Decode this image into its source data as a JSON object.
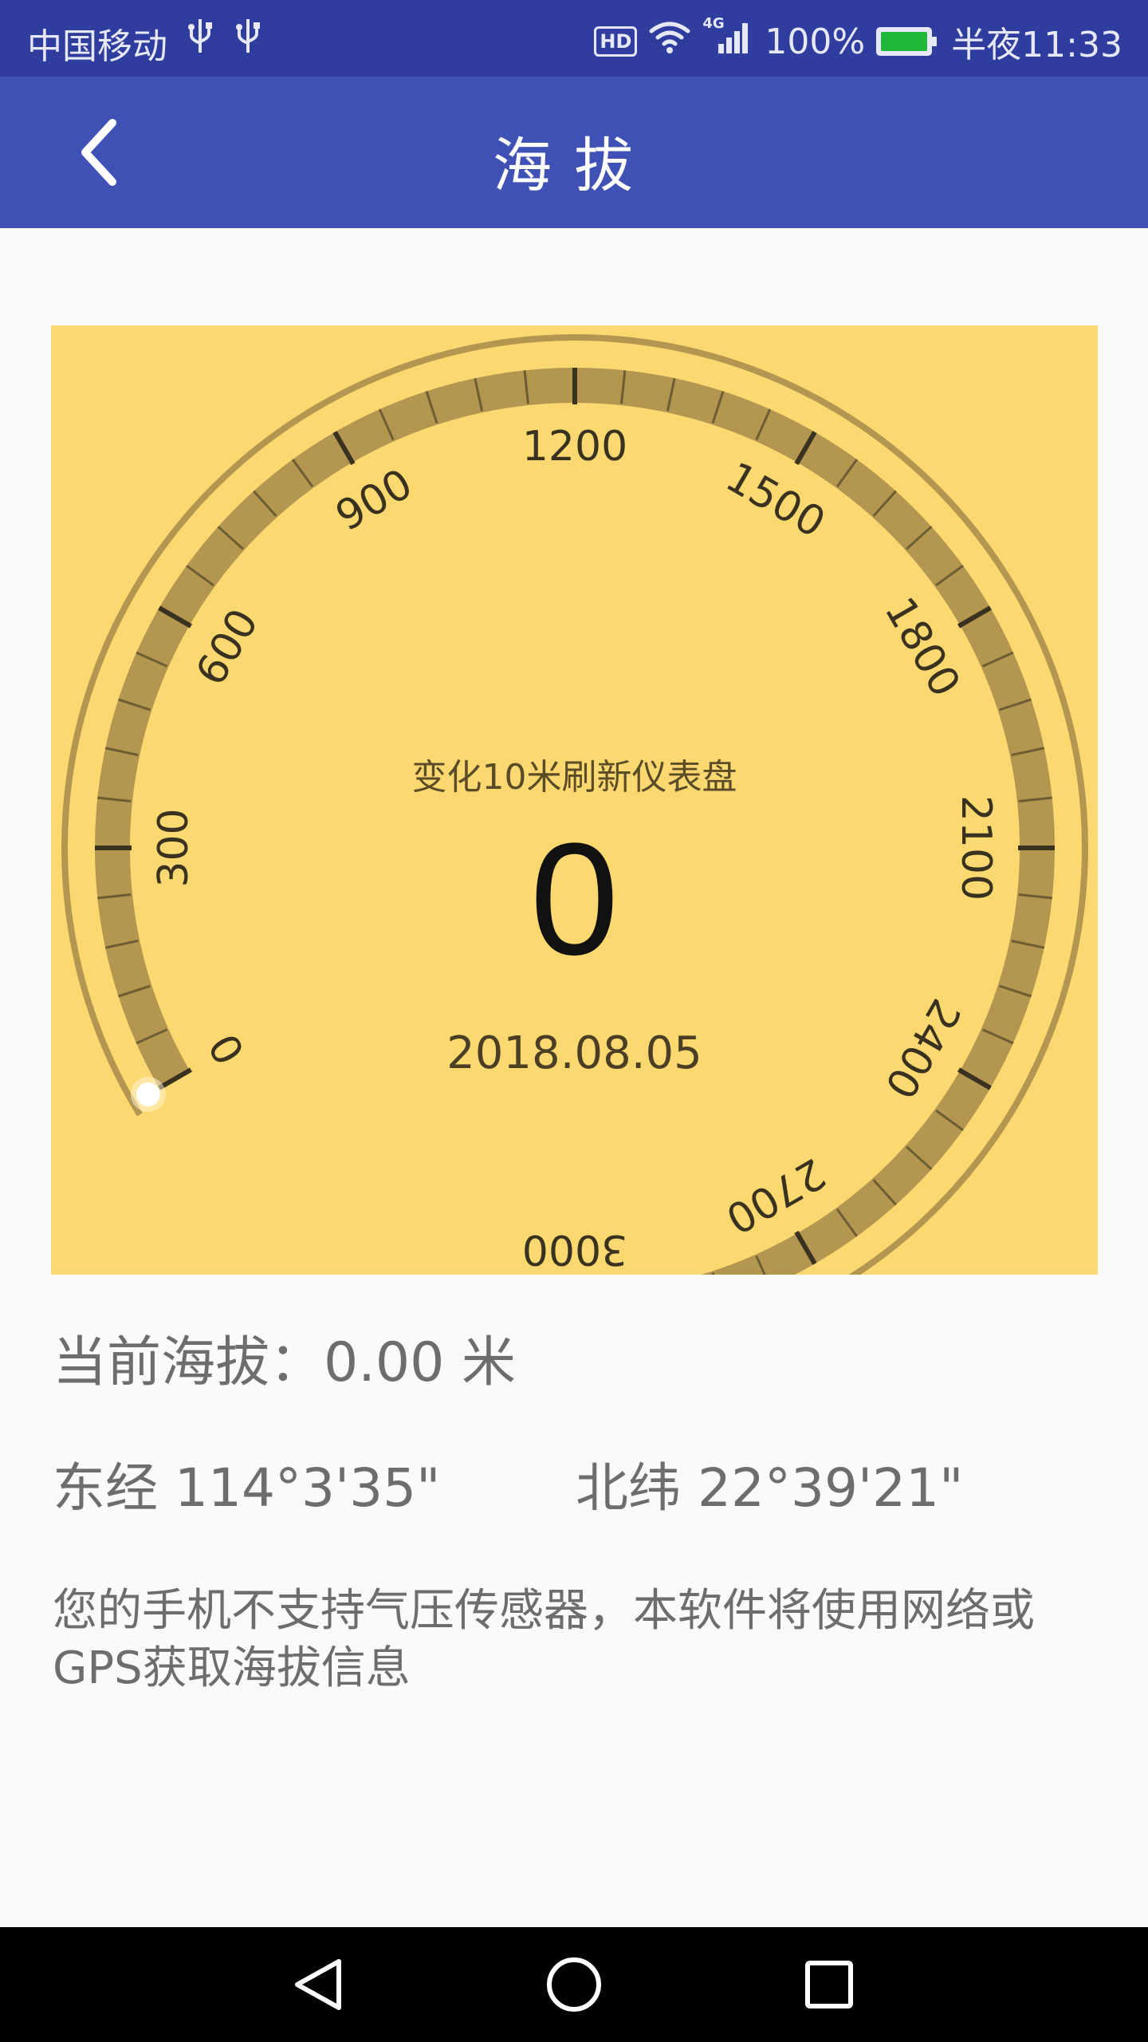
{
  "status_bar": {
    "carrier": "中国移动",
    "network": "4G",
    "battery_percent": "100%",
    "time": "半夜11:33",
    "icons": [
      "usb-icon",
      "usb-icon",
      "hd-icon",
      "wifi-icon",
      "signal-icon",
      "battery-charging-icon"
    ]
  },
  "app_bar": {
    "title": "海拔",
    "back_icon": "chevron-left-icon",
    "color": "#3f51b5"
  },
  "gauge": {
    "refresh_label": "变化10米刷新仪表盘",
    "reading": "0",
    "date": "2018.08.05",
    "min": 0,
    "max": 3000,
    "value": 0,
    "major_step": 300,
    "tick_labels": [
      "0",
      "300",
      "600",
      "900",
      "1200",
      "1500",
      "1800",
      "2100",
      "2400",
      "2700",
      "3000"
    ],
    "background": "#fcd970",
    "band_color": "#b39650"
  },
  "info": {
    "current_altitude": "当前海拔：0.00 米",
    "longitude": "东经 114°3'35\"",
    "latitude": "北纬 22°39'21\"",
    "notice": "您的手机不支持气压传感器，本软件将使用网络或GPS获取海拔信息"
  },
  "nav_bar": {
    "buttons": [
      "back-triangle-icon",
      "home-circle-icon",
      "recents-square-icon"
    ]
  }
}
